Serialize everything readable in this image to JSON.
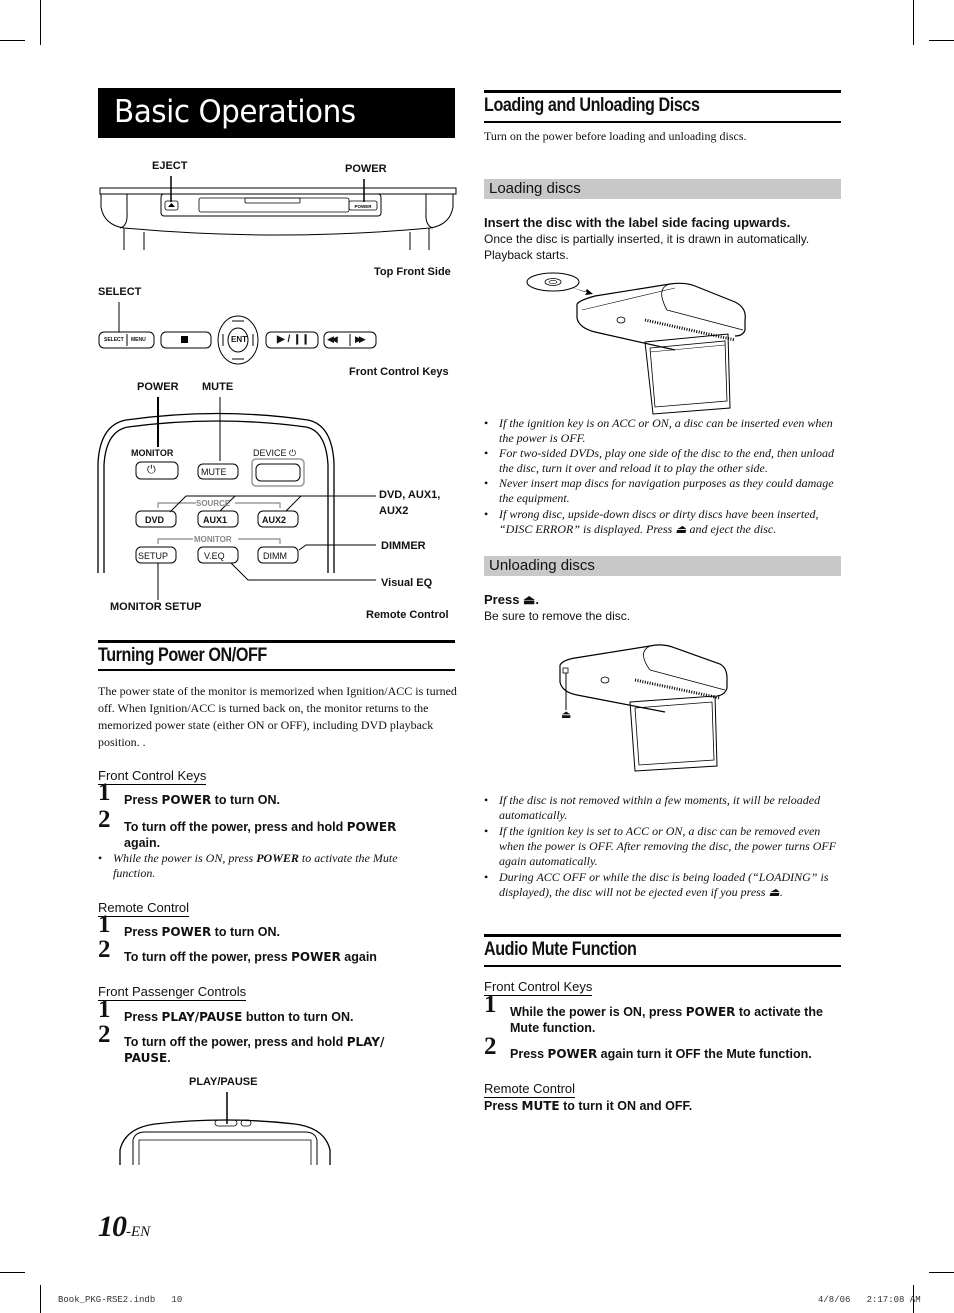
{
  "page": {
    "title": "Basic Operations",
    "page_number": "10",
    "page_suffix": "-EN",
    "footer_left": "Book_PKG-RSE2.indb   10",
    "footer_right": "4/8/06   2:17:08 AM"
  },
  "diagrams": {
    "top_front": {
      "callouts": {
        "eject": "EJECT",
        "power": "POWER"
      },
      "button_power": "POWER",
      "caption": "Top Front Side"
    },
    "front_keys": {
      "callouts": {
        "select": "SELECT"
      },
      "buttons": {
        "select": "SELECT",
        "menu": "MENU",
        "stop": "■",
        "ent": "ENT",
        "play_pause": "▶ / ❙❙",
        "prev": "◀◀",
        "next": "▶▶"
      },
      "caption": "Front Control Keys"
    },
    "remote": {
      "callouts": {
        "power": "POWER",
        "mute": "MUTE",
        "dvd_aux": "DVD, AUX1,",
        "dvd_aux2": "AUX2",
        "dimmer": "DIMMER",
        "visual_eq": "Visual EQ",
        "monitor_setup": "MONITOR SETUP"
      },
      "labels": {
        "monitor": "MONITOR",
        "device": "DEVICE",
        "source": "SOURCE",
        "monitor_group": "MONITOR"
      },
      "buttons": {
        "power": "⏻",
        "mute": "MUTE",
        "dvd": "DVD",
        "aux1": "AUX1",
        "aux2": "AUX2",
        "setup": "SETUP",
        "veq": "V.EQ",
        "dimm": "DIMM"
      },
      "caption": "Remote Control"
    },
    "passenger": {
      "callouts": {
        "play_pause": "PLAY/PAUSE"
      }
    }
  },
  "turning_power": {
    "heading": "Turning Power ON/OFF",
    "intro": "The power state of the monitor is memorized when Ignition/ACC is turned off.  When Ignition/ACC is turned back on, the monitor returns to the memorized power state (either ON or OFF), including DVD playback position. .",
    "front_keys": {
      "heading": "Front Control Keys",
      "steps": [
        {
          "num": "1",
          "pre": "Press ",
          "key": "POWER",
          "post": " to turn ON."
        },
        {
          "num": "2",
          "pre": "To turn off the power, press and hold ",
          "key": "POWER",
          "post": " again."
        }
      ],
      "note": {
        "pre": "While the power is ON, press ",
        "key": "POWER",
        "post": " to activate the Mute function."
      }
    },
    "remote": {
      "heading": "Remote Control",
      "steps": [
        {
          "num": "1",
          "pre": "Press ",
          "key": "POWER",
          "post": " to turn ON."
        },
        {
          "num": "2",
          "pre": "To turn off the power, press ",
          "key": "POWER",
          "post": " again"
        }
      ]
    },
    "passenger": {
      "heading": "Front Passenger Controls",
      "steps": [
        {
          "num": "1",
          "pre": "Press ",
          "key": "PLAY/PAUSE",
          "post": " button to turn ON."
        },
        {
          "num": "2",
          "pre": "To turn off the power, press and hold ",
          "key": "PLAY/ PAUSE",
          "post": "."
        }
      ]
    }
  },
  "discs": {
    "heading": "Loading and Unloading Discs",
    "intro": "Turn on the power before loading and unloading discs.",
    "loading": {
      "heading": "Loading discs",
      "instruction": "Insert the disc with the label side facing upwards.",
      "desc1": "Once the disc is partially inserted, it is drawn in automatically.",
      "desc2": "Playback starts.",
      "notes": [
        "If the ignition key is on ACC or ON, a disc can be inserted even when the power is OFF.",
        "For two-sided DVDs, play one side of the disc to the end, then unload the disc, turn it over and reload it to play the other side.",
        "Never insert map discs for navigation purposes as they could damage the equipment.",
        "If wrong disc, upside-down discs or dirty discs have been inserted, “DISC ERROR” is displayed. Press ⏏ and eject the disc."
      ]
    },
    "unloading": {
      "heading": "Unloading discs",
      "instruction": "Press ⏏.",
      "desc": "Be sure to remove the disc.",
      "eject_symbol": "⏏",
      "notes": [
        "If the disc is not removed within a few moments, it will be reloaded automatically.",
        "If the ignition key is set to ACC or ON, a disc can be removed even when the power is OFF. After removing the disc, the power turns OFF again automatically.",
        "During ACC OFF or while the disc is being loaded (“LOADING” is displayed), the disc will not be ejected even if you press ⏏."
      ]
    }
  },
  "mute": {
    "heading": "Audio Mute Function",
    "front_keys": {
      "heading": "Front Control Keys",
      "steps": [
        {
          "num": "1",
          "pre": "While the power is ON, press ",
          "key": "POWER",
          "post": " to activate the Mute function."
        },
        {
          "num": "2",
          "pre": "Press ",
          "key": "POWER",
          "post": " again turn it OFF the Mute function."
        }
      ]
    },
    "remote": {
      "heading": "Remote Control",
      "pre": "Press ",
      "key": "MUTE",
      "post": " to turn it ON and OFF."
    }
  }
}
